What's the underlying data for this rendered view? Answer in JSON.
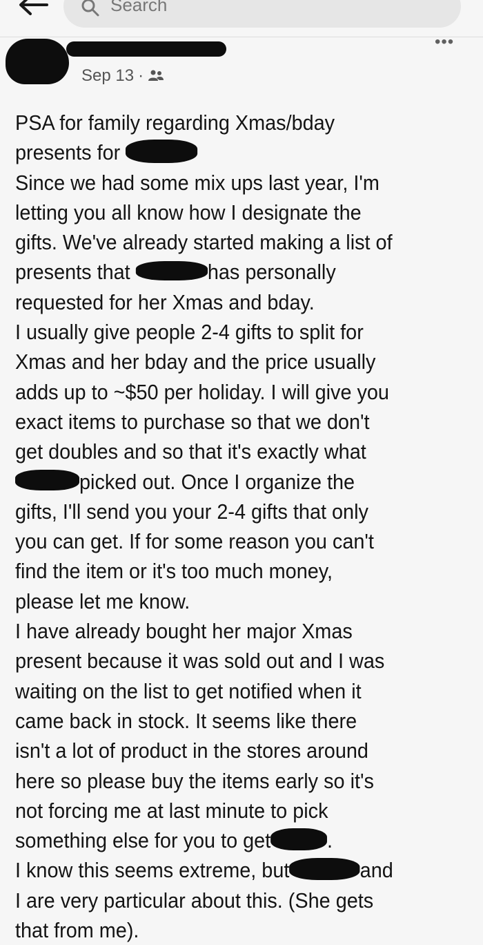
{
  "search": {
    "placeholder": "Search"
  },
  "post": {
    "date": "Sep 13",
    "separator": "·",
    "audience_icon": "friends-icon",
    "more_icon": "more-options-icon",
    "more_glyph": "•••",
    "lines": [
      "PSA for family regarding Xmas/bday",
      "presents for",
      "Since we had some mix ups last year, I'm",
      "letting you all know how I designate the",
      "gifts. We've already started making a list of",
      [
        "presents that",
        "has personally"
      ],
      "requested for her Xmas and bday.",
      "I usually give people 2-4 gifts to split for",
      "Xmas and her bday and the price usually",
      "adds up to ~$50 per holiday. I will give you",
      "exact items to purchase so that we don't",
      "get doubles and so that it's exactly what",
      "picked out.  Once I organize the",
      "gifts, I'll send you your 2-4 gifts that only",
      "you can get. If for some reason you can't",
      "find the item or it's too much money,",
      "please let me know.",
      "I have already bought her major Xmas",
      "present because it was sold out and I was",
      "waiting on the list to get notified when it",
      "came back in stock. It seems like there",
      "isn't a lot of product in the stores around",
      "here so please buy the items early so it's",
      "not forcing me at last minute to pick",
      [
        "something else for you to get",
        "."
      ],
      [
        "I know this seems extreme, but",
        "and"
      ],
      "I are very particular about this. (She gets",
      "that from me)."
    ]
  }
}
